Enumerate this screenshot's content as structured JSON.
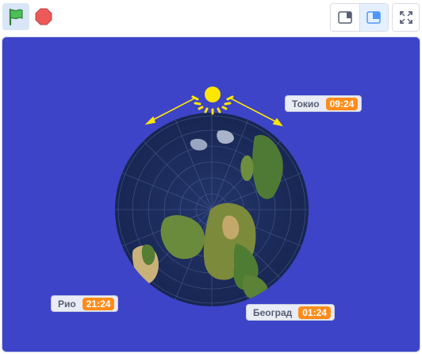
{
  "toolbar": {
    "flag_icon": "green-flag-icon",
    "stop_icon": "stop-icon",
    "small_stage_icon": "small-stage-icon",
    "large_stage_icon": "large-stage-icon",
    "fullscreen_icon": "fullscreen-icon"
  },
  "stage": {
    "background_color": "#3d44c8",
    "monitors": [
      {
        "label": "Токио",
        "value": "09:24"
      },
      {
        "label": "Рио",
        "value": "21:24"
      },
      {
        "label": "Београд",
        "value": "01:24"
      }
    ]
  },
  "colors": {
    "accent_orange": "#ff8c1a",
    "sun_yellow": "#ffe600",
    "flag_green": "#4cbf56",
    "stop_red": "#ec5959"
  }
}
